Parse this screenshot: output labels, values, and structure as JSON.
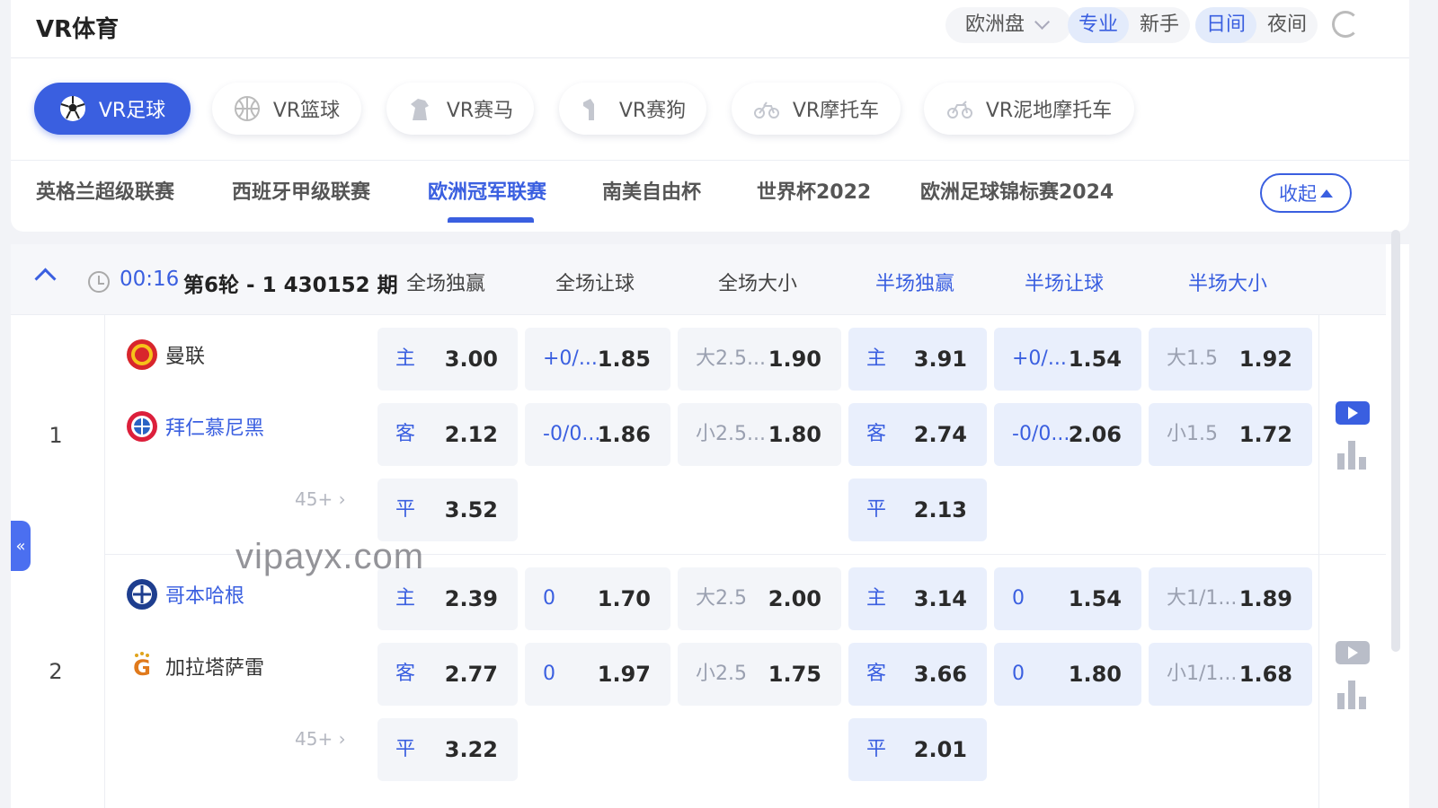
{
  "header": {
    "title": "VR体育",
    "market_select": "欧洲盘",
    "mode": [
      "专业",
      "新手"
    ],
    "theme": [
      "日间",
      "夜间"
    ],
    "active_mode": "专业",
    "active_theme": "日间"
  },
  "sports": [
    {
      "label": "VR足球",
      "icon": "soccer-ball-icon",
      "active": true
    },
    {
      "label": "VR篮球",
      "icon": "basketball-icon",
      "active": false
    },
    {
      "label": "VR赛马",
      "icon": "horse-icon",
      "active": false
    },
    {
      "label": "VR赛狗",
      "icon": "dog-icon",
      "active": false
    },
    {
      "label": "VR摩托车",
      "icon": "motorcycle-icon",
      "active": false
    },
    {
      "label": "VR泥地摩托车",
      "icon": "dirtbike-icon",
      "active": false
    }
  ],
  "leagues": [
    {
      "label": "英格兰超级联赛",
      "active": false
    },
    {
      "label": "西班牙甲级联赛",
      "active": false
    },
    {
      "label": "欧洲冠军联赛",
      "active": true
    },
    {
      "label": "南美自由杯",
      "active": false
    },
    {
      "label": "世界杯2022",
      "active": false
    },
    {
      "label": "欧洲足球锦标赛2024",
      "active": false
    }
  ],
  "collapse_label": "收起",
  "round_header": {
    "timer": "00:16",
    "round": "第6轮 - 1",
    "period": "430152 期",
    "markets": [
      "全场独赢",
      "全场让球",
      "全场大小",
      "半场独赢",
      "半场让球",
      "半场大小"
    ]
  },
  "matches": [
    {
      "no": "1",
      "home": "曼联",
      "away": "拜仁慕尼黑",
      "more": "45+",
      "ft_1x2": {
        "home": [
          "主",
          "3.00"
        ],
        "away": [
          "客",
          "2.12"
        ],
        "draw": [
          "平",
          "3.52"
        ]
      },
      "ft_hcp": {
        "home": [
          "+0/...",
          "1.85"
        ],
        "away": [
          "-0/0...",
          "1.86"
        ]
      },
      "ft_ou": {
        "over": [
          "大2.5...",
          "1.90"
        ],
        "under": [
          "小2.5...",
          "1.80"
        ]
      },
      "ht_1x2": {
        "home": [
          "主",
          "3.91"
        ],
        "away": [
          "客",
          "2.74"
        ],
        "draw": [
          "平",
          "2.13"
        ]
      },
      "ht_hcp": {
        "home": [
          "+0/...",
          "1.54"
        ],
        "away": [
          "-0/0...",
          "2.06"
        ]
      },
      "ht_ou": {
        "over": [
          "大1.5",
          "1.92"
        ],
        "under": [
          "小1.5",
          "1.72"
        ]
      },
      "live": true
    },
    {
      "no": "2",
      "home": "哥本哈根",
      "away": "加拉塔萨雷",
      "more": "45+",
      "ft_1x2": {
        "home": [
          "主",
          "2.39"
        ],
        "away": [
          "客",
          "2.77"
        ],
        "draw": [
          "平",
          "3.22"
        ]
      },
      "ft_hcp": {
        "home": [
          "0",
          "1.70"
        ],
        "away": [
          "0",
          "1.97"
        ]
      },
      "ft_ou": {
        "over": [
          "大2.5",
          "2.00"
        ],
        "under": [
          "小2.5",
          "1.75"
        ]
      },
      "ht_1x2": {
        "home": [
          "主",
          "3.14"
        ],
        "away": [
          "客",
          "3.66"
        ],
        "draw": [
          "平",
          "2.01"
        ]
      },
      "ht_hcp": {
        "home": [
          "0",
          "1.54"
        ],
        "away": [
          "0",
          "1.80"
        ]
      },
      "ht_ou": {
        "over": [
          "大1/1...",
          "1.89"
        ],
        "under": [
          "小1/1...",
          "1.68"
        ]
      },
      "live": false
    }
  ],
  "watermark": "vipayx.com",
  "colors": {
    "accent": "#3a5fe0",
    "cell_bg": "#f3f5f9",
    "half_bg": "#e9effc"
  }
}
